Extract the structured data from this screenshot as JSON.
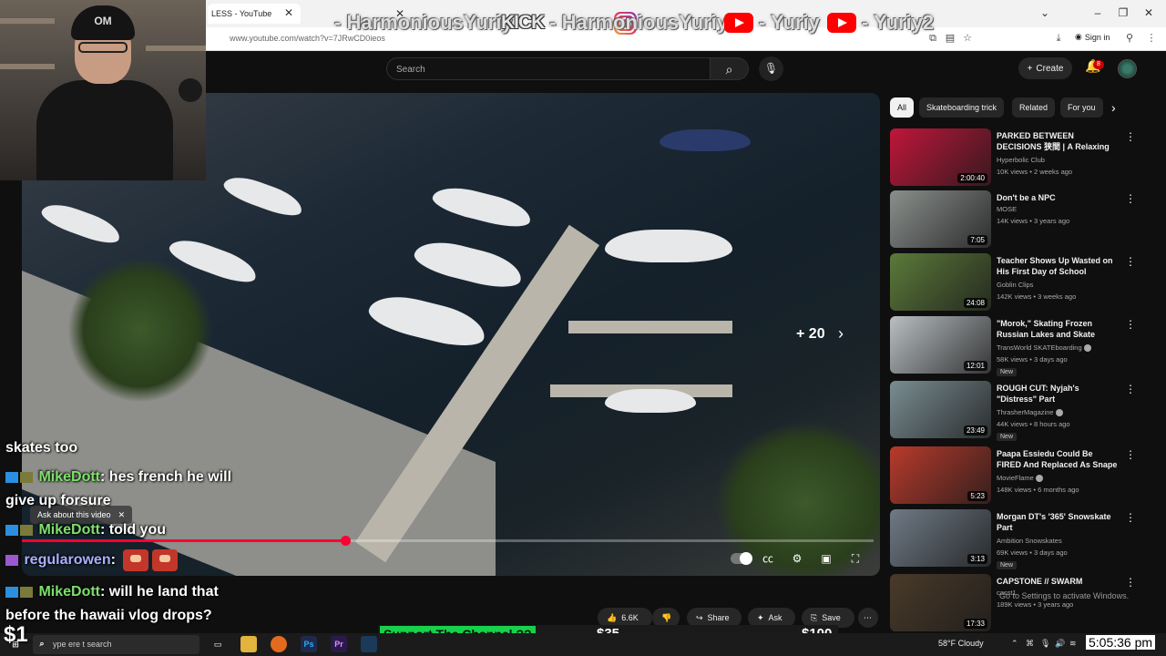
{
  "browser": {
    "tab_title": "LESS - YouTube",
    "url": "www.youtube.com/watch?v=7JRwCD0ieos",
    "signin_label": "Sign in"
  },
  "overlay": {
    "instagram": "- HarmoniousYuriy",
    "kick_logo": "KICK",
    "kick": "- HarmoniousYuriy",
    "youtube1": "- Yuriy",
    "youtube2": "- Yuriy2"
  },
  "youtube": {
    "search_placeholder": "Search",
    "create_label": "Create",
    "notification_count": "8"
  },
  "video": {
    "more_count": "+ 20",
    "progress_fraction": 0.38,
    "ask_label": "Ask about this video"
  },
  "chat": [
    {
      "text": "skates too",
      "user": "",
      "message": ""
    },
    {
      "user": "MikeDott",
      "message": ": hes french he will"
    },
    {
      "text": "give up forsure",
      "user": "",
      "message": ""
    },
    {
      "user": "MikeDott",
      "message": ": told you"
    },
    {
      "user": "regularowen",
      "message": ":"
    },
    {
      "user": "MikeDott",
      "message": ": will he land that"
    },
    {
      "text": "before the hawaii vlog drops?",
      "user": "",
      "message": ""
    }
  ],
  "actions": {
    "likes": "6.6K",
    "share": "Share",
    "ask": "Ask",
    "save": "Save"
  },
  "chips": [
    "All",
    "Skateboarding trick",
    "Related",
    "For you"
  ],
  "recommendations": [
    {
      "title": "PARKED BETWEEN DECISIONS 狭間 | A Relaxing Reflection ...",
      "channel": "Hyperbolic Club",
      "meta": "10K views • 2 weeks ago",
      "duration": "2:00:40",
      "new": "",
      "color": "#c0163a"
    },
    {
      "title": "Don't be a NPC",
      "channel": "MOSE",
      "meta": "14K views • 3 years ago",
      "duration": "7:05",
      "new": "",
      "color": "#8a8f8c"
    },
    {
      "title": "Teacher Shows Up Wasted on His First Day of School",
      "channel": "Goblin Clips",
      "meta": "142K views • 3 weeks ago",
      "duration": "24:08",
      "new": "",
      "color": "#5b7a3a"
    },
    {
      "title": "\"Morok,\" Skating Frozen Russian Lakes and Skate Spots Made ...",
      "channel": "TransWorld SKATEboarding",
      "meta": "58K views • 3 days ago",
      "duration": "12:01",
      "new": "New",
      "color": "#b9bfc2"
    },
    {
      "title": "ROUGH CUT: Nyjah's \"Distress\" Part",
      "channel": "ThrasherMagazine",
      "meta": "44K views • 8 hours ago",
      "duration": "23:49",
      "new": "New",
      "color": "#7a8d92"
    },
    {
      "title": "Paapa Essiedu Could Be FIRED And Replaced As Snape - My ...",
      "channel": "MovieFlame",
      "meta": "148K views • 6 months ago",
      "duration": "5:23",
      "new": "",
      "color": "#b83a2c"
    },
    {
      "title": "Morgan DT's '365' Snowskate Part",
      "channel": "Ambition Snowskates",
      "meta": "69K views • 3 days ago",
      "duration": "3:13",
      "new": "New",
      "color": "#6f7a86"
    },
    {
      "title": "CAPSTONE // SWARM",
      "channel": "casst1",
      "meta": "189K views • 3 years ago",
      "duration": "17:33",
      "new": "",
      "color": "#4a3a2a"
    }
  ],
  "support": {
    "label": "Support The Channel ??",
    "amount1": "$35",
    "amount2": "$100"
  },
  "taskbar": {
    "search_placeholder": "ype  ere t  search",
    "weather": "58°F  Cloudy",
    "clock": "5:05:36 pm",
    "activate": "Go to Settings to activate Windows."
  },
  "cheer": "$1"
}
